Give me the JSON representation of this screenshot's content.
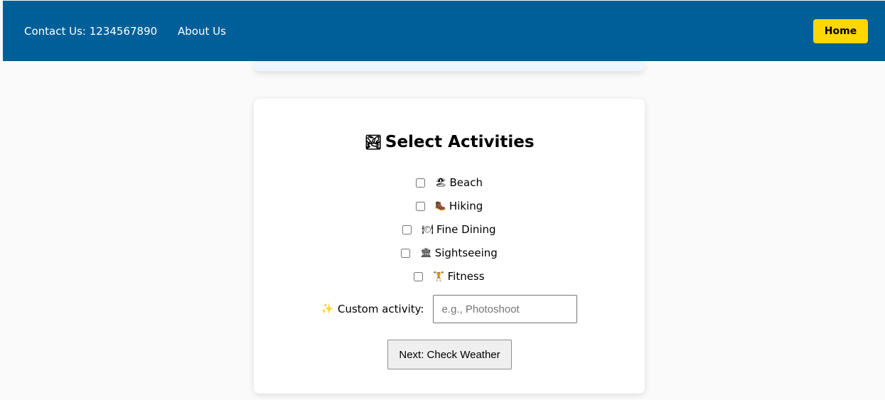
{
  "nav": {
    "contact": "Contact Us: 1234567890",
    "about": "About Us",
    "home": "Home",
    "bar_color": "#005f99",
    "home_color": "#ffd700"
  },
  "card": {
    "title": "Select Activities",
    "title_icon": "mountain-icon"
  },
  "activities": [
    {
      "label": "Beach",
      "icon": "beach-icon",
      "glyph": "🏖",
      "checked": false
    },
    {
      "label": "Hiking",
      "icon": "hiking-boot-icon",
      "glyph": "🥾",
      "checked": false
    },
    {
      "label": "Fine Dining",
      "icon": "dining-plate-icon",
      "glyph": "🍽",
      "checked": false
    },
    {
      "label": "Sightseeing",
      "icon": "landmark-icon",
      "glyph": "🏛",
      "checked": false
    },
    {
      "label": "Fitness",
      "icon": "dumbbell-icon",
      "glyph": "🏋",
      "checked": false
    }
  ],
  "custom": {
    "label": "Custom activity:",
    "icon": "sparkles-icon",
    "placeholder": "e.g., Photoshoot",
    "value": ""
  },
  "next_button": "Next: Check Weather"
}
